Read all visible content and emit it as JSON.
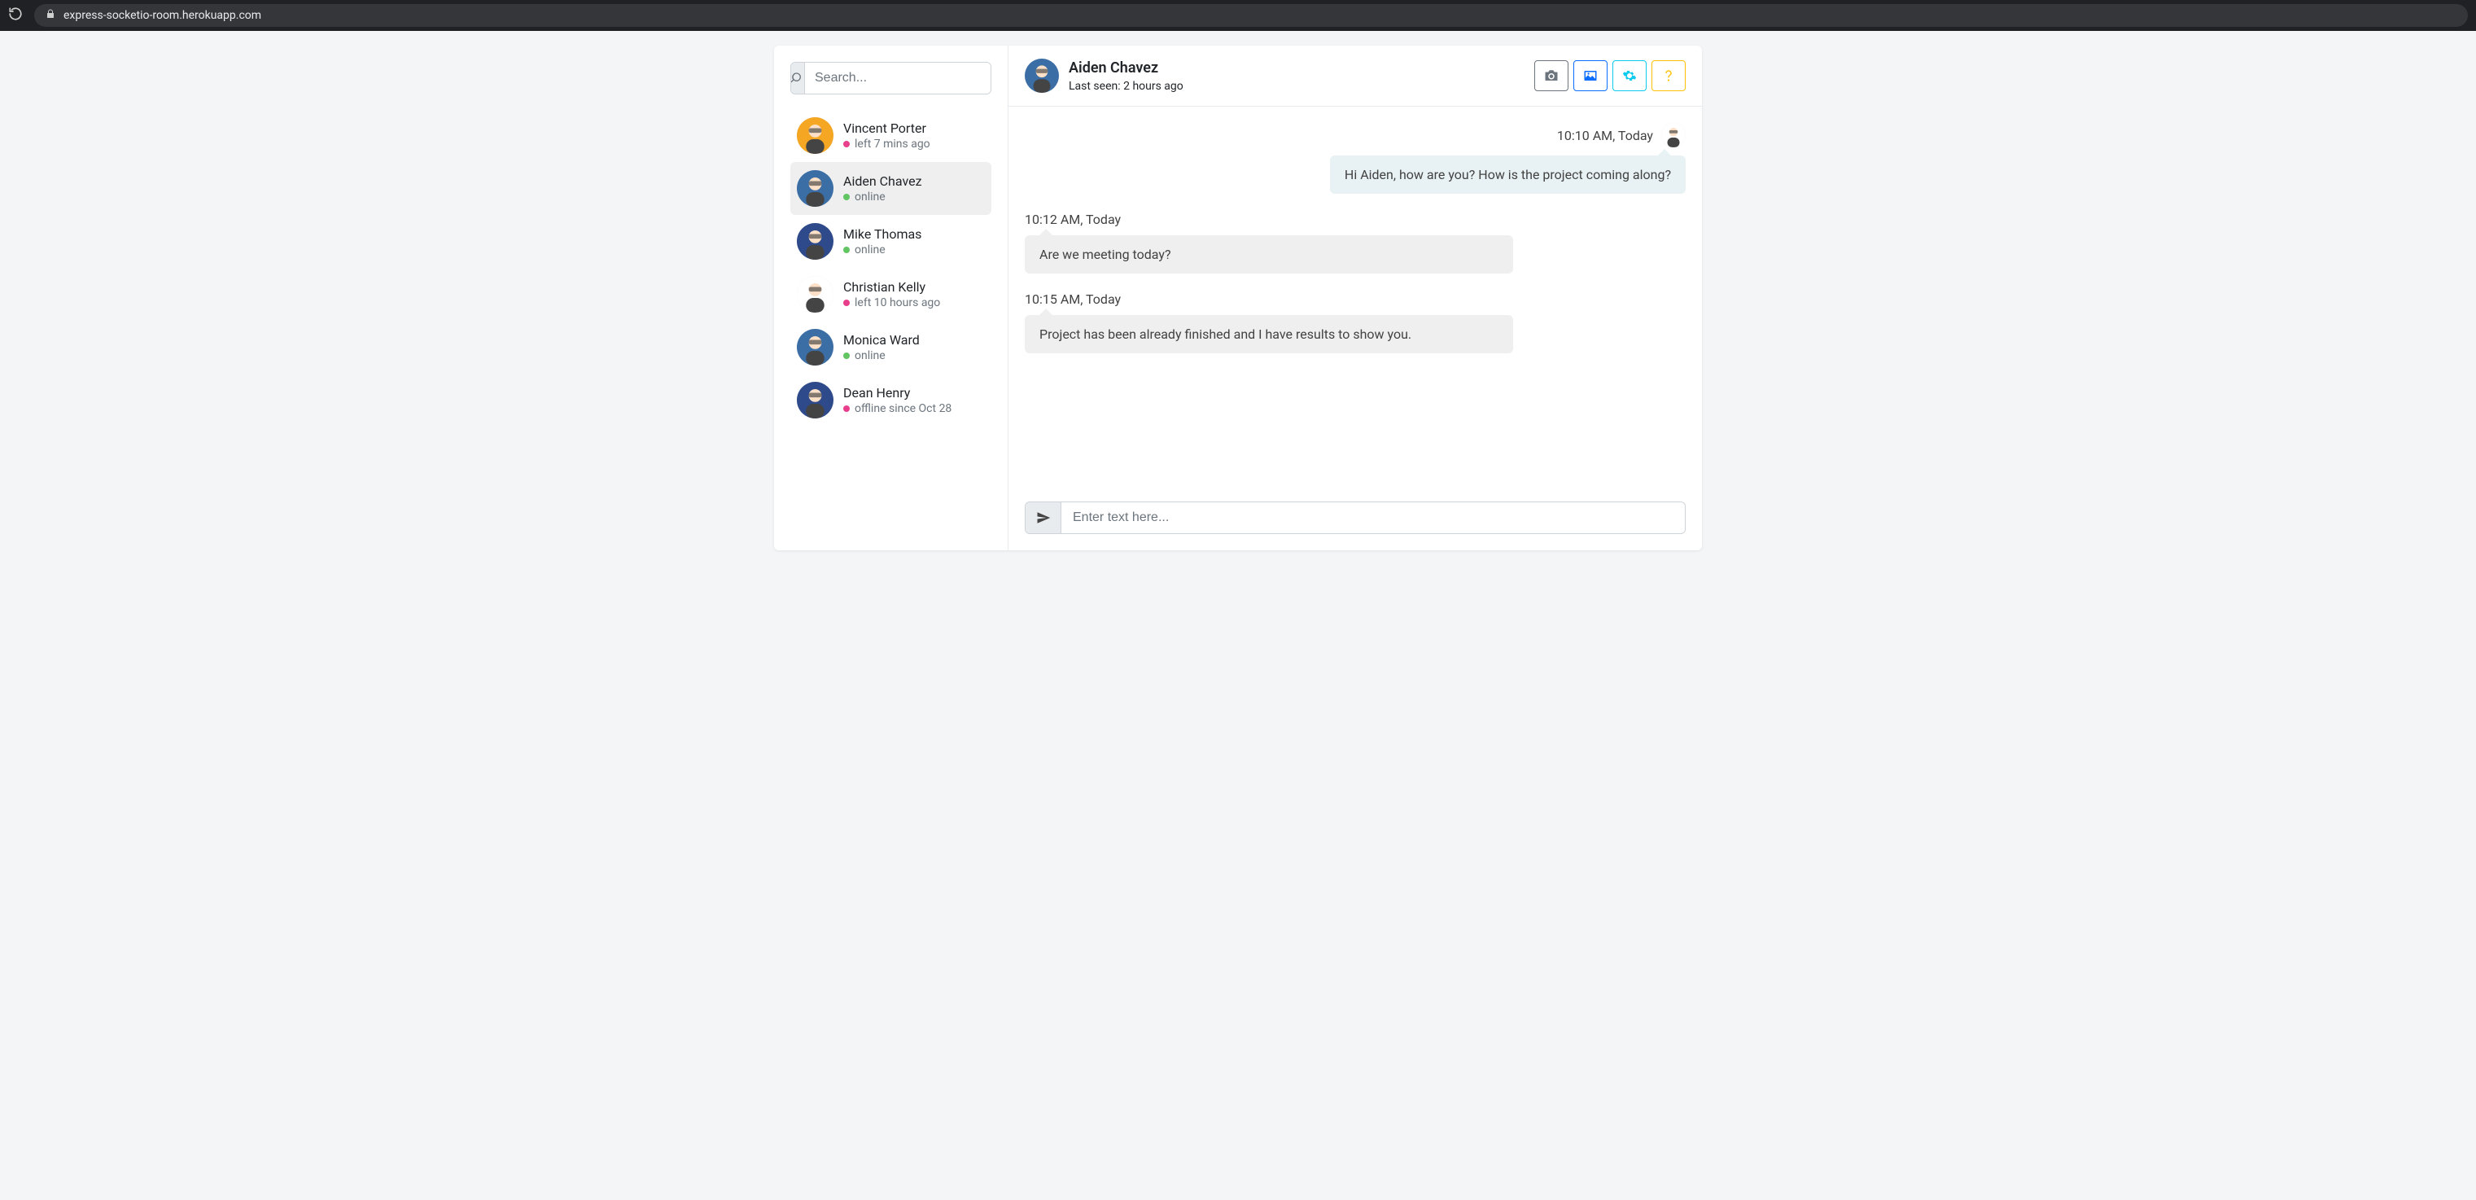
{
  "browser": {
    "url": "express-socketio-room.herokuapp.com"
  },
  "sidebar": {
    "search_placeholder": "Search...",
    "contacts": [
      {
        "name": "Vincent Porter",
        "status_text": "left 7 mins ago",
        "status_color": "pink",
        "active": false
      },
      {
        "name": "Aiden Chavez",
        "status_text": "online",
        "status_color": "green",
        "active": true
      },
      {
        "name": "Mike Thomas",
        "status_text": "online",
        "status_color": "green",
        "active": false
      },
      {
        "name": "Christian Kelly",
        "status_text": "left 10 hours ago",
        "status_color": "pink",
        "active": false
      },
      {
        "name": "Monica Ward",
        "status_text": "online",
        "status_color": "green",
        "active": false
      },
      {
        "name": "Dean Henry",
        "status_text": "offline since Oct 28",
        "status_color": "pink",
        "active": false
      }
    ]
  },
  "header": {
    "name": "Aiden Chavez",
    "subtitle": "Last seen: 2 hours ago",
    "action_icons": [
      "camera",
      "image",
      "cogs",
      "question"
    ]
  },
  "messages": [
    {
      "side": "right",
      "time": "10:10 AM, Today",
      "text": "Hi Aiden, how are you? How is the project coming along?",
      "show_avatar": true
    },
    {
      "side": "left",
      "time": "10:12 AM, Today",
      "text": "Are we meeting today?",
      "show_avatar": false
    },
    {
      "side": "left",
      "time": "10:15 AM, Today",
      "text": "Project has been already finished and I have results to show you.",
      "show_avatar": false
    }
  ],
  "compose": {
    "placeholder": "Enter text here..."
  },
  "avatar_colors": [
    "#f5a623",
    "#3b6ea5",
    "#2e4a8a",
    "#ffffff",
    "#3b6ea5",
    "#2e4a8a"
  ]
}
